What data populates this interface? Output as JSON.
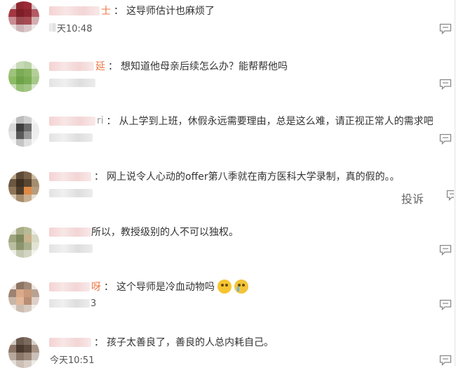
{
  "comments": [
    {
      "name_tail": "士",
      "text": "这导师估计也麻烦了",
      "time_visible": "天10:48"
    },
    {
      "name_tail": "延",
      "text": "想知道他母亲后续怎么办？能帮帮他吗",
      "time_visible": ""
    },
    {
      "name_tail": "ri",
      "text": "从上学到上班，休假永远需要理由，总是这么难，请正视正常人的需求吧",
      "time_visible": ""
    },
    {
      "name_tail": "",
      "text": "网上说令人心动的offer第八季就在南方医科大学录制，真的假的。。",
      "time_visible": ""
    },
    {
      "name_tail": "",
      "text": "所以，教授级别的人不可以独权。",
      "time_visible": ""
    },
    {
      "name_tail": "呀",
      "text": "这个导师是冷血动物吗",
      "time_visible": "3"
    },
    {
      "name_tail": "",
      "text": "孩子太善良了，善良的人总内耗自己。",
      "time_visible": "今天10:51"
    }
  ],
  "separator": "：",
  "report_label": "投诉",
  "icons": {
    "reply": "reply-comment-icon",
    "report": "report-icon"
  },
  "colors": {
    "name_accent": "#eb7340",
    "text": "#333333",
    "time": "#666666"
  }
}
